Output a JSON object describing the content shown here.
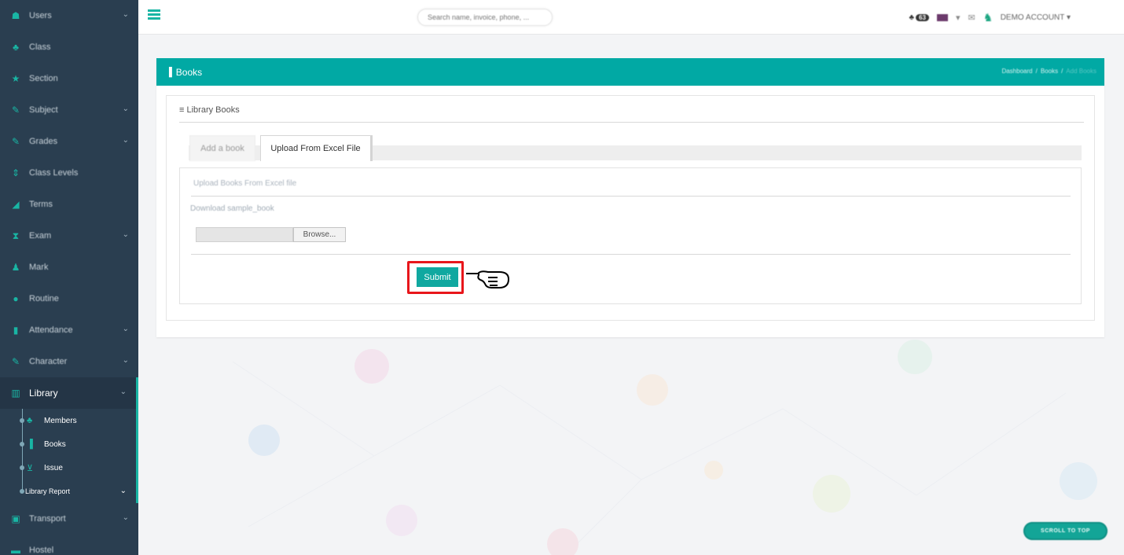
{
  "sidebar": {
    "items": [
      {
        "label": "Users",
        "icon": "users-icon",
        "glyph": "☗",
        "chevron": true
      },
      {
        "label": "Class",
        "icon": "class-icon",
        "glyph": "♣",
        "chevron": false
      },
      {
        "label": "Section",
        "icon": "star-icon",
        "glyph": "★",
        "chevron": false
      },
      {
        "label": "Subject",
        "icon": "edit-icon",
        "glyph": "✎",
        "chevron": true
      },
      {
        "label": "Grades",
        "icon": "edit-icon",
        "glyph": "✎",
        "chevron": true
      },
      {
        "label": "Class Levels",
        "icon": "sort-icon",
        "glyph": "⇕",
        "chevron": false
      },
      {
        "label": "Terms",
        "icon": "signal-icon",
        "glyph": "◢",
        "chevron": false
      },
      {
        "label": "Exam",
        "icon": "hourglass-icon",
        "glyph": "⧗",
        "chevron": true
      },
      {
        "label": "Mark",
        "icon": "user-icon",
        "glyph": "♟",
        "chevron": false
      },
      {
        "label": "Routine",
        "icon": "circle-icon",
        "glyph": "●",
        "chevron": false
      },
      {
        "label": "Attendance",
        "icon": "clipboard-icon",
        "glyph": "▮",
        "chevron": true
      },
      {
        "label": "Character",
        "icon": "edit-icon",
        "glyph": "✎",
        "chevron": true
      }
    ],
    "library": {
      "label": "Library",
      "icon": "library-icon",
      "glyph": "▥",
      "subitems": [
        {
          "label": "Members",
          "icon": "members-icon",
          "glyph": "♣"
        },
        {
          "label": "Books",
          "icon": "book-icon",
          "glyph": "▐"
        },
        {
          "label": "Issue",
          "icon": "cart-icon",
          "glyph": "⊻"
        },
        {
          "label": "Library Report",
          "icon": "",
          "glyph": ""
        }
      ]
    },
    "after": [
      {
        "label": "Transport",
        "icon": "bus-icon",
        "glyph": "▣",
        "chevron": true
      },
      {
        "label": "Hostel",
        "icon": "bed-icon",
        "glyph": "▬",
        "chevron": false
      }
    ]
  },
  "topbar": {
    "search_placeholder": "Search name, invoice, phone, ...",
    "notif_count": "63",
    "account_label": "DEMO ACCOUNT ▾"
  },
  "panel": {
    "title": "Books",
    "breadcrumb": [
      "Dashboard",
      "/",
      "Books",
      "/",
      "Add Books"
    ],
    "box_title": "Library Books",
    "tabs": [
      "Add a book",
      "Upload From Excel File"
    ],
    "content_title": "Upload Books From Excel file",
    "download_link": "Download sample_book",
    "browse_label": "Browse...",
    "submit_label": "Submit"
  },
  "scroll_top_label": "SCROLL TO TOP",
  "colors": {
    "sidebar_bg": "#2a3e50",
    "accent": "#01a9a4",
    "highlight": "#e8161b"
  }
}
